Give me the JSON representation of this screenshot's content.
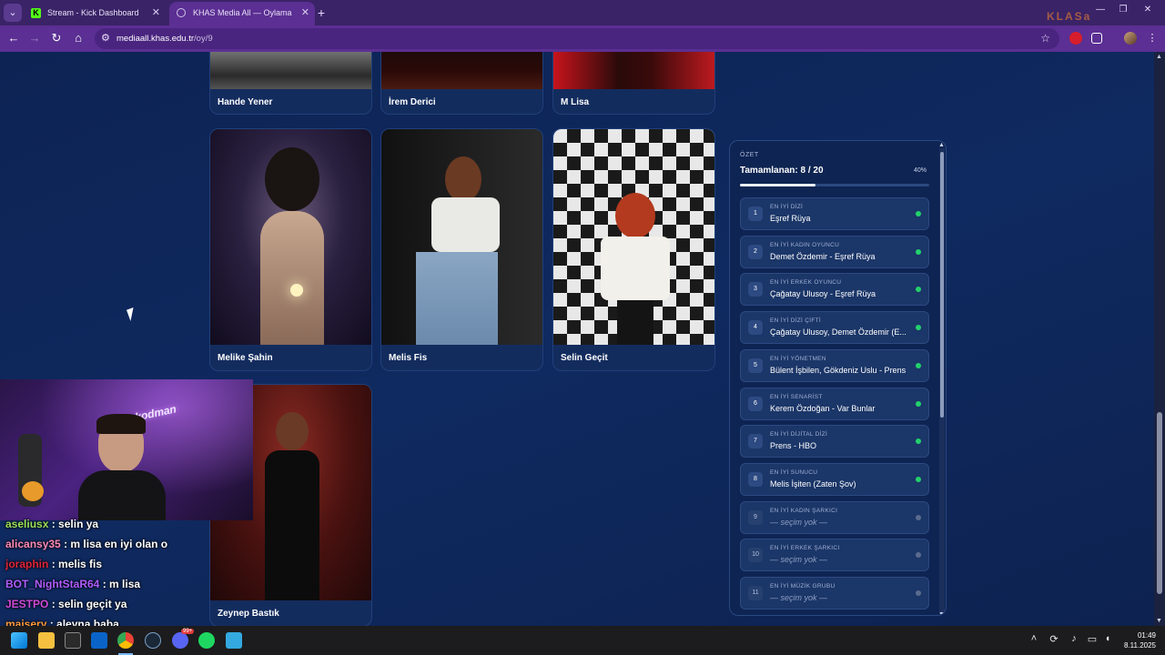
{
  "browser": {
    "tabs": [
      {
        "title": "Stream - Kick Dashboard",
        "favicon": "kick-logo-icon",
        "active": false
      },
      {
        "title": "KHAS Media All — Oylama",
        "favicon": "globe-icon",
        "active": true
      }
    ],
    "address": {
      "host": "mediaall.khas.edu.tr",
      "path": "/oy/9"
    },
    "brand_watermark": "KLASa"
  },
  "grid": {
    "row1": [
      "Hande Yener",
      "İrem Derici",
      "M Lisa"
    ],
    "row2": [
      "Melike Şahin",
      "Melis Fis",
      "Selin Geçit"
    ],
    "row3": [
      "Zeynep Bastık"
    ]
  },
  "summary": {
    "label": "ÖZET",
    "completed": "Tamamlanan: 8 / 20",
    "percent_text": "40%",
    "percent": 0.4,
    "categories": [
      {
        "num": "1",
        "title": "EN İYİ DİZİ",
        "value": "Eşref Rüya",
        "status": "selected"
      },
      {
        "num": "2",
        "title": "EN İYİ KADIN OYUNCU",
        "value": "Demet Özdemir - Eşref Rüya",
        "status": "selected"
      },
      {
        "num": "3",
        "title": "EN İYİ ERKEK OYUNCU",
        "value": "Çağatay Ulusoy - Eşref Rüya",
        "status": "selected"
      },
      {
        "num": "4",
        "title": "EN İYİ DİZİ ÇİFTİ",
        "value": "Çağatay Ulusoy, Demet Özdemir (E...",
        "status": "selected"
      },
      {
        "num": "5",
        "title": "EN İYİ YÖNETMEN",
        "value": "Bülent İşbilen, Gökdeniz Uslu - Prens",
        "status": "selected"
      },
      {
        "num": "6",
        "title": "EN İYİ SENARİST",
        "value": "Kerem Özdoğan - Var Bunlar",
        "status": "selected"
      },
      {
        "num": "7",
        "title": "EN İYİ DİJİTAL DİZİ",
        "value": "Prens - HBO",
        "status": "selected"
      },
      {
        "num": "8",
        "title": "EN İYİ SUNUCU",
        "value": "Melis İşiten (Zaten Şov)",
        "status": "selected"
      },
      {
        "num": "9",
        "title": "EN İYİ KADIN ŞARKICI",
        "value": "— seçim yok —",
        "status": "empty"
      },
      {
        "num": "10",
        "title": "EN İYİ ERKEK ŞARKICI",
        "value": "— seçim yok —",
        "status": "empty"
      },
      {
        "num": "11",
        "title": "EN İYİ MÜZİK GRUBU",
        "value": "— seçim yok —",
        "status": "empty"
      }
    ]
  },
  "webcam": {
    "neon_sign": "kodman"
  },
  "chat": [
    {
      "user": "aseliusx",
      "color": "#9be05a",
      "text": ": selin ya"
    },
    {
      "user": "alicansy35",
      "color": "#ff8ab8",
      "text": ": m lisa en iyi olan o"
    },
    {
      "user": "joraphin",
      "color": "#e0243a",
      "text": ": melis fis"
    },
    {
      "user": "BOT_NightStaR64",
      "color": "#b05cff",
      "text": ": m lisa"
    },
    {
      "user": "JESTPO",
      "color": "#d04ad8",
      "text": ": selin geçit ya"
    },
    {
      "user": "maisery",
      "color": "#ff9a3c",
      "text": ": aleyna baba"
    }
  ],
  "taskbar": {
    "apps": [
      "windows-start-icon",
      "file-explorer-icon",
      "store-icon",
      "outlook-icon",
      "chrome-icon",
      "steam-icon",
      "discord-icon",
      "spotify-icon",
      "notepad-icon"
    ],
    "discord_badge": "99+",
    "time": "01:49",
    "date": "8.11.2025"
  }
}
